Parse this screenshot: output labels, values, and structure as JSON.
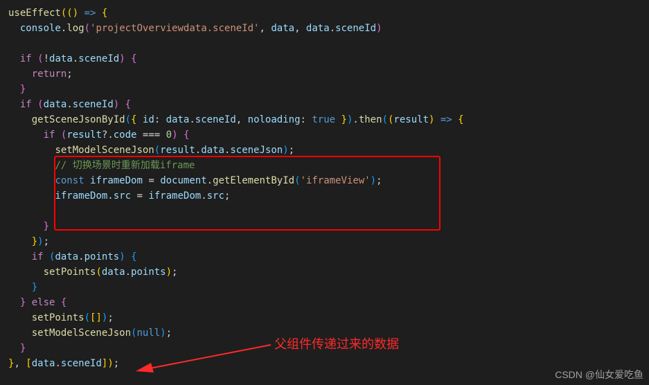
{
  "code": {
    "lines": [
      "useEffect(() => {",
      "  console.log('projectOverviewdata.sceneId', data, data.sceneId)",
      "",
      "  if (!data.sceneId) {",
      "    return;",
      "  }",
      "  if (data.sceneId) {",
      "    getSceneJsonById({ id: data.sceneId, noloading: true }).then((result) => {",
      "      if (result?.code === 0) {",
      "        setModelSceneJson(result.data.sceneJson);",
      "        // 切换场景时重新加载iframe",
      "        const iframeDom = document.getElementById('iframeView');",
      "        iframeDom.src = iframeDom.src;",
      "",
      "      }",
      "    });",
      "    if (data.points) {",
      "      setPoints(data.points);",
      "    }",
      "  } else {",
      "    setPoints([]);",
      "    setModelSceneJson(null);",
      "  }",
      "}, [data.sceneId]);"
    ],
    "string_log": "'projectOverviewdata.sceneId'",
    "string_iframe": "'iframeView'",
    "comment": "// 切换场景时重新加载iframe",
    "num_zero": "0",
    "bool_true": "true",
    "bool_null": "null"
  },
  "annotation": {
    "label": "父组件传递过来的数据"
  },
  "watermark": {
    "text": "CSDN @仙女爱吃鱼"
  }
}
